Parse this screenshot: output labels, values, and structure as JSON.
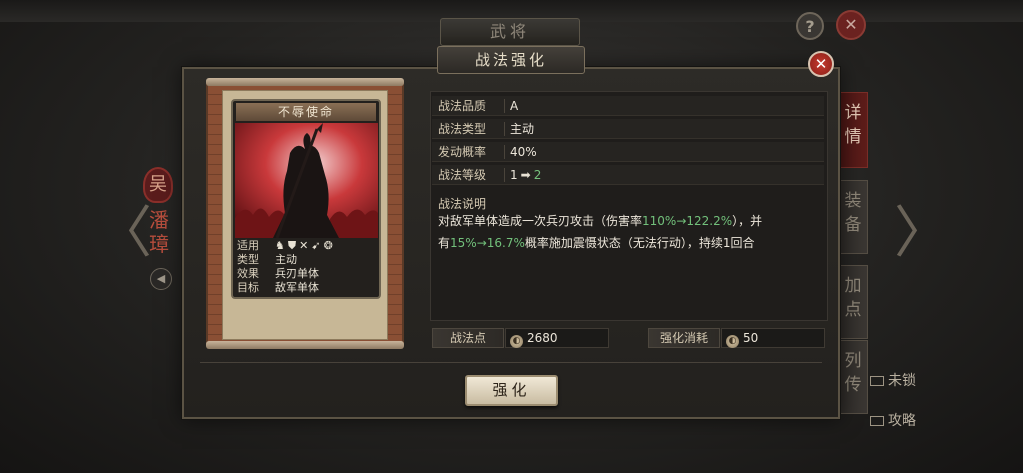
{
  "background": {
    "screen_title": "武将",
    "hero_badge": "吴",
    "hero_name": "潘璋",
    "side_tabs": [
      "详情",
      "装备",
      "加点",
      "列传"
    ],
    "links": {
      "unlock": "未锁",
      "guide": "攻略"
    }
  },
  "modal": {
    "title": "战法强化",
    "card": {
      "name": "不辱使命",
      "attrs": [
        {
          "label": "适用",
          "value": ""
        },
        {
          "label": "类型",
          "value": "主动"
        },
        {
          "label": "效果",
          "value": "兵刃单体"
        },
        {
          "label": "目标",
          "value": "敌军单体"
        }
      ],
      "unit_icons": [
        "cavalry-icon",
        "shield-icon",
        "pike-icon",
        "bow-icon",
        "mechanism-icon"
      ]
    },
    "info": {
      "quality": {
        "label": "战法品质",
        "value": "A"
      },
      "type": {
        "label": "战法类型",
        "value": "主动"
      },
      "chance": {
        "label": "发动概率",
        "value": "40%"
      },
      "level": {
        "label": "战法等级",
        "from": "1",
        "arrow": "➡",
        "to": "2"
      }
    },
    "description": {
      "title": "战法说明",
      "line1_pre": "对敌军单体造成一次兵刃攻击（伤害率",
      "line1_hl": "110%→122.2%",
      "line1_post": "），并",
      "line2_pre": "有",
      "line2_hl": "15%→16.7%",
      "line2_post": "概率施加震慑状态（无法行动），持续1回合"
    },
    "costs": {
      "points_label": "战法点",
      "points_value": "2680",
      "cost_label": "强化消耗",
      "cost_value": "50"
    },
    "upgrade_button": "强化"
  },
  "colors": {
    "highlight": "#72c07b",
    "accent_red": "#c63a2f",
    "panel": "#1f1d1b"
  }
}
